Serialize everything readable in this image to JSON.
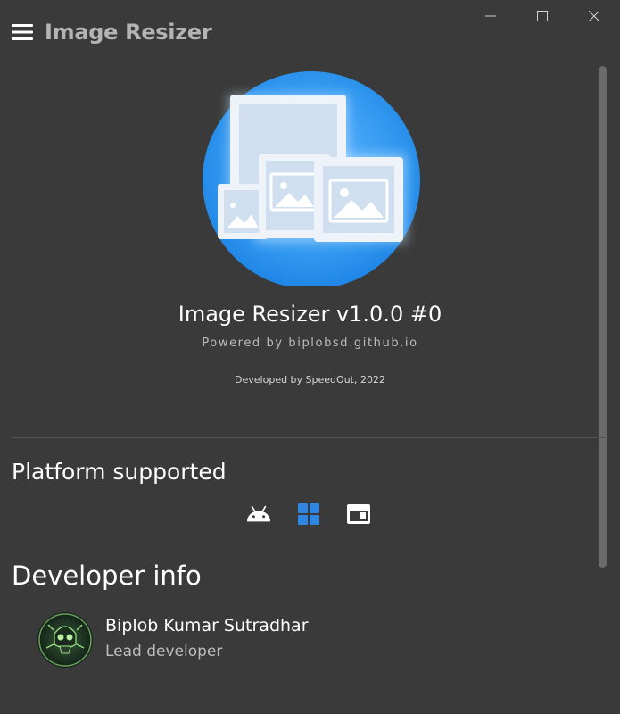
{
  "app": {
    "title": "Image Resizer"
  },
  "window_controls": {
    "minimize_icon": "minimize-icon",
    "maximize_icon": "maximize-icon",
    "close_icon": "close-icon"
  },
  "about": {
    "title": "Image Resizer v1.0.0 #0",
    "powered_by": "Powered by biplobsd.github.io",
    "developed_by": "Developed by SpeedOut, 2022"
  },
  "platform": {
    "title": "Platform supported",
    "icons": [
      "android-icon",
      "windows-icon",
      "web-icon"
    ],
    "accent_color": "#2f86e0"
  },
  "developer": {
    "title": "Developer info",
    "name": "Biplob Kumar Sutradhar",
    "role": "Lead developer"
  },
  "colors": {
    "background": "#3a3a3a",
    "logo_blue": "#2a8fe8",
    "title_gray": "#b4b4b4"
  }
}
